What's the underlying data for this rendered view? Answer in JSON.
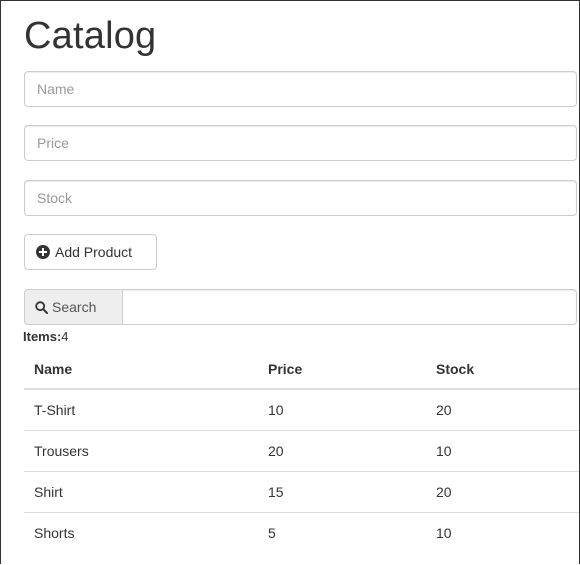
{
  "page": {
    "title": "Catalog"
  },
  "form": {
    "name_placeholder": "Name",
    "price_placeholder": "Price",
    "stock_placeholder": "Stock",
    "add_button_label": "Add Product",
    "add_button_icon": "plus-circle-icon"
  },
  "search": {
    "label": "Search",
    "icon": "search-icon",
    "value": ""
  },
  "items": {
    "label": "Items:",
    "count": "4"
  },
  "table": {
    "headers": [
      "Name",
      "Price",
      "Stock"
    ],
    "rows": [
      {
        "name": "T-Shirt",
        "price": "10",
        "stock": "20"
      },
      {
        "name": "Trousers",
        "price": "20",
        "stock": "10"
      },
      {
        "name": "Shirt",
        "price": "15",
        "stock": "20"
      },
      {
        "name": "Shorts",
        "price": "5",
        "stock": "10"
      }
    ]
  }
}
